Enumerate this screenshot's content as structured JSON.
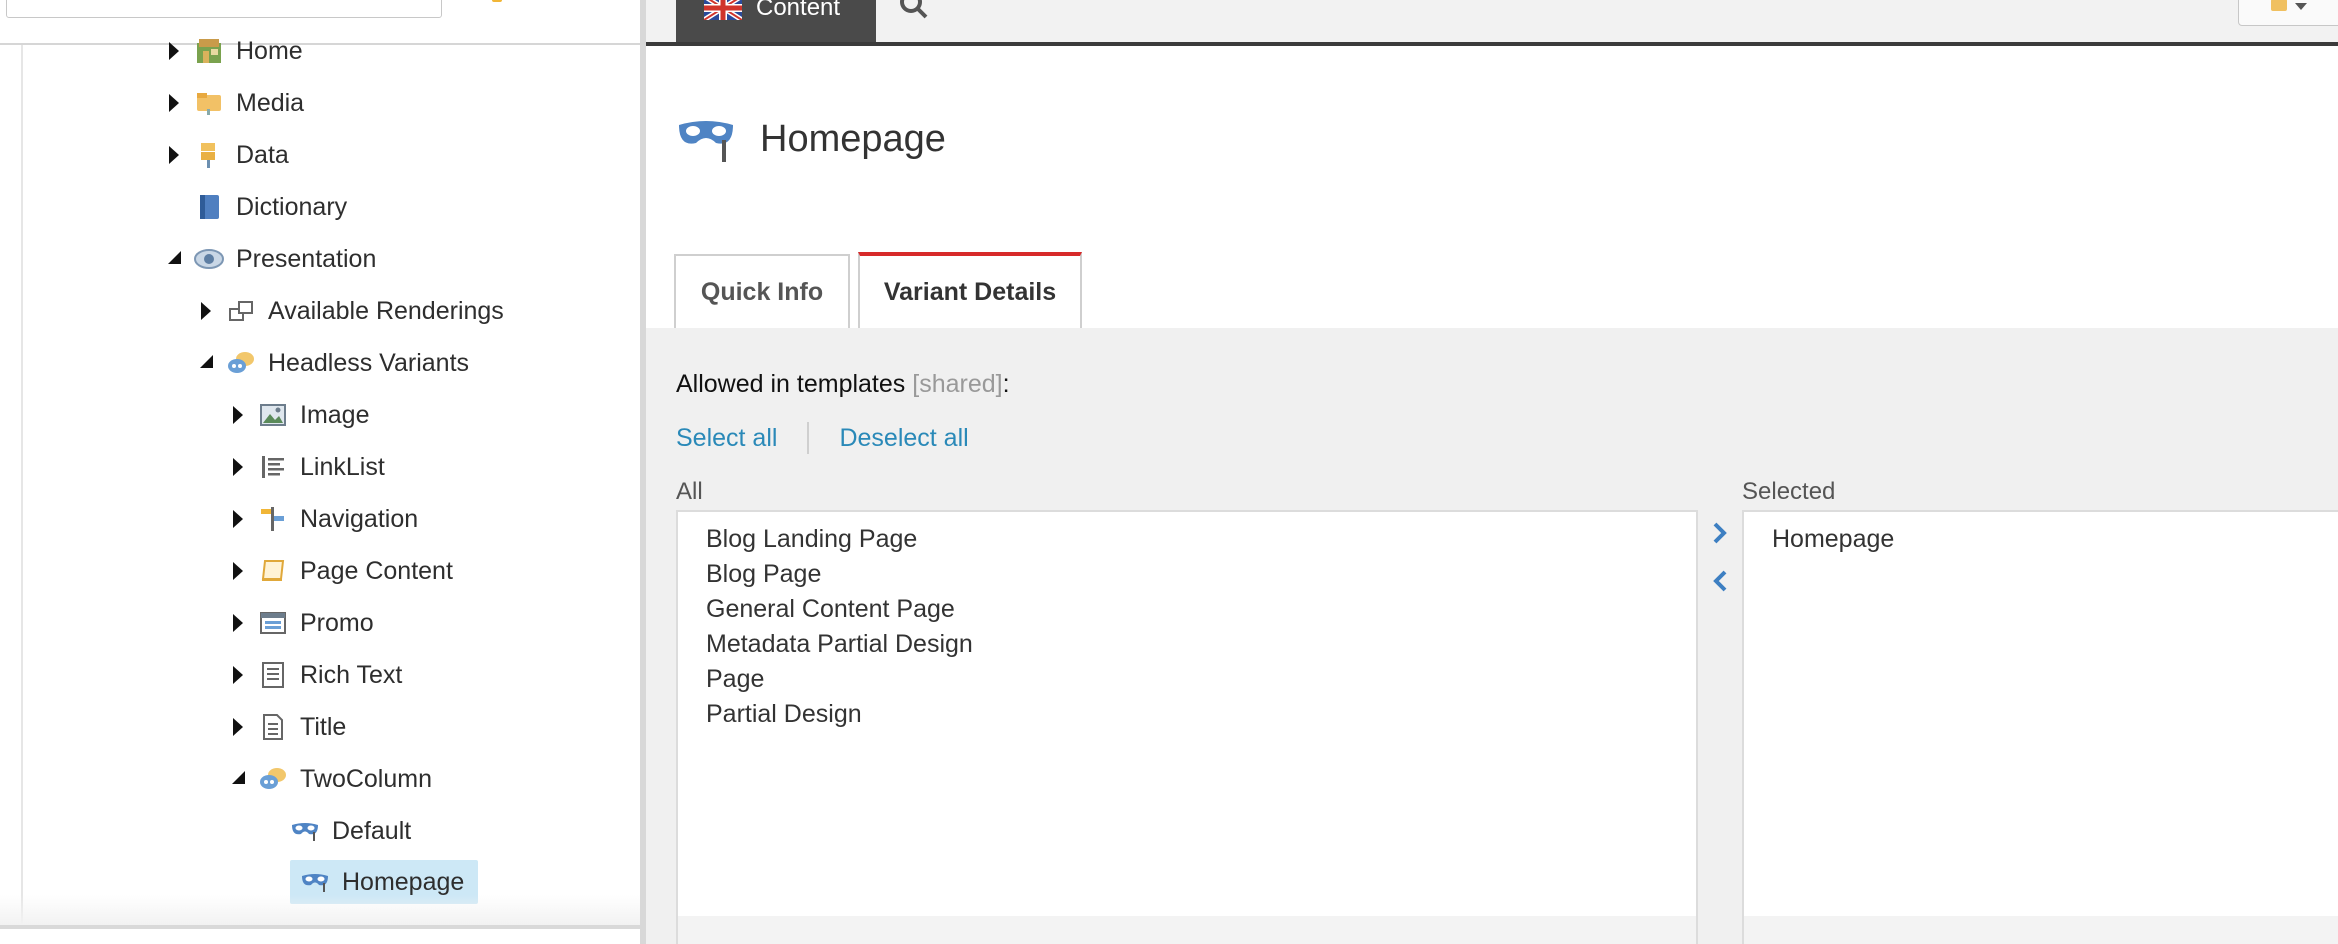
{
  "tree": {
    "items": [
      {
        "label": "Home",
        "icon": "home-icon"
      },
      {
        "label": "Media",
        "icon": "media-folder-icon"
      },
      {
        "label": "Data",
        "icon": "data-icon"
      },
      {
        "label": "Dictionary",
        "icon": "dictionary-book-icon"
      },
      {
        "label": "Presentation",
        "icon": "eye-icon"
      },
      {
        "label": "Available Renderings",
        "icon": "renderings-icon"
      },
      {
        "label": "Headless Variants",
        "icon": "variants-icon"
      },
      {
        "label": "Image",
        "icon": "image-icon"
      },
      {
        "label": "LinkList",
        "icon": "list-icon"
      },
      {
        "label": "Navigation",
        "icon": "signpost-icon"
      },
      {
        "label": "Page Content",
        "icon": "page-content-icon"
      },
      {
        "label": "Promo",
        "icon": "promo-icon"
      },
      {
        "label": "Rich Text",
        "icon": "rich-text-icon"
      },
      {
        "label": "Title",
        "icon": "document-icon"
      },
      {
        "label": "TwoColumn",
        "icon": "variants-icon"
      },
      {
        "label": "Default",
        "icon": "mask-icon"
      },
      {
        "label": "Homepage",
        "icon": "mask-icon"
      }
    ],
    "selected": "Homepage"
  },
  "topbar": {
    "content_tab_label": "Content",
    "flag_icon": "uk-flag-icon",
    "search_icon": "search-icon"
  },
  "item": {
    "title": "Homepage",
    "icon": "mask-icon"
  },
  "tabs": [
    {
      "label": "Quick Info"
    },
    {
      "label": "Variant Details"
    }
  ],
  "active_tab": "Variant Details",
  "field": {
    "label": "Allowed in templates",
    "shared": "[shared]",
    "suffix": ":",
    "select_all": "Select all",
    "deselect_all": "Deselect all",
    "all_caption": "All",
    "selected_caption": "Selected",
    "all_items": [
      "Blog Landing Page",
      "Blog Page",
      "General Content Page",
      "Metadata Partial Design",
      "Page",
      "Partial Design"
    ],
    "selected_items": [
      "Homepage"
    ]
  },
  "colors": {
    "accent_link": "#2a89b8",
    "active_tab_border": "#d72a2a",
    "selection_bg": "#cde8f6",
    "topbar_tab_bg": "#4a4a4a"
  }
}
